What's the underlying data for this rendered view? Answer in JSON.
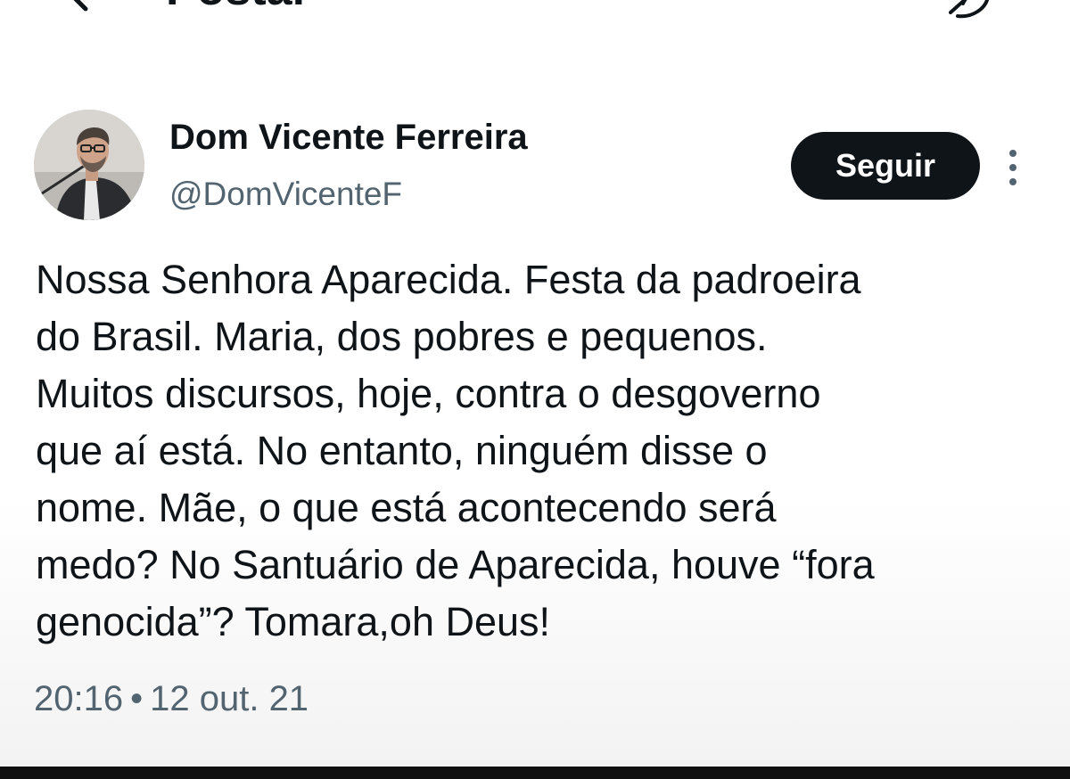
{
  "header": {
    "title": "Postar",
    "back_icon": "arrow-left-icon",
    "grok_icon": "grok-icon"
  },
  "author": {
    "name": "Dom Vicente Ferreira",
    "handle": "@DomVicenteF",
    "avatar": "avatar-photo"
  },
  "actions": {
    "follow_label": "Seguir",
    "more_icon": "more-vertical-icon"
  },
  "tweet": {
    "lines": [
      "Nossa Senhora Aparecida. Festa da padroeira",
      "do Brasil. Maria, dos pobres e pequenos.",
      "Muitos discursos, hoje, contra o desgoverno",
      "que aí está. No entanto, ninguém disse o",
      "nome. Mãe, o que está acontecendo será",
      "medo? No Santuário de Aparecida, houve “fora",
      "genocida”? Tomara,oh Deus!"
    ]
  },
  "meta": {
    "time": "20:16",
    "separator": "•",
    "date": "12 out. 21"
  },
  "colors": {
    "text": "#0f1419",
    "secondary": "#536471",
    "button_bg": "#0f1419",
    "button_text": "#ffffff"
  }
}
